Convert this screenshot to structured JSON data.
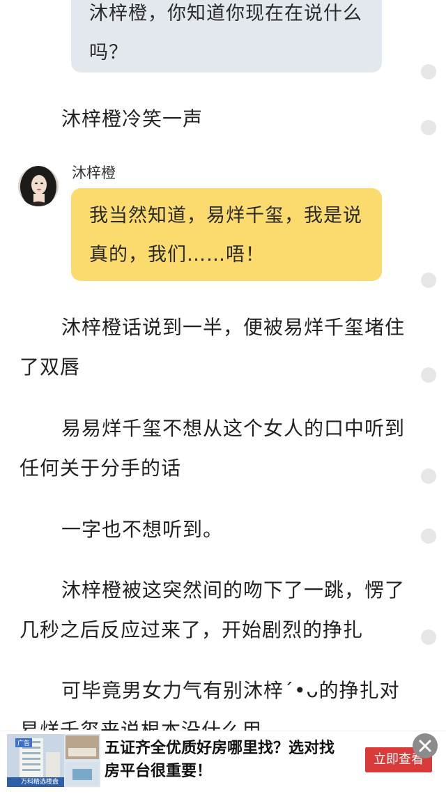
{
  "story": {
    "bubble_top": "沐梓橙，你知道你现在在说什么吗？",
    "para_1": "沐梓橙冷笑一声",
    "speaker": "沐梓橙",
    "bubble_speech": "我当然知道，易烊千玺，我是说真的，我们……唔！",
    "para_2": "沐梓橙话说到一半，便被易烊千玺堵住了双唇",
    "para_3": "易易烊千玺不想从这个女人的口中听到任何关于分手的话",
    "para_4": "一字也不想听到。",
    "para_5": "沐梓橙被这突然间的吻下了一跳，愣了几秒之后反应过来了，开始剧烈的挣扎",
    "para_6": "可毕竟男女力气有别沐梓´•ᴗ的挣扎对易烊千玺来说根本没什么用"
  },
  "ad": {
    "text": "五证齐全优质好房哪里找？选对找房平台很重要！",
    "button": "立即查看",
    "close_icon": "close-icon",
    "thumb_caption": "万科精选楼盘",
    "tag": "广告"
  },
  "colors": {
    "bubble_grey": "#e3e8ee",
    "bubble_yellow": "#fbdb6d",
    "ad_button": "#d93a3a"
  }
}
